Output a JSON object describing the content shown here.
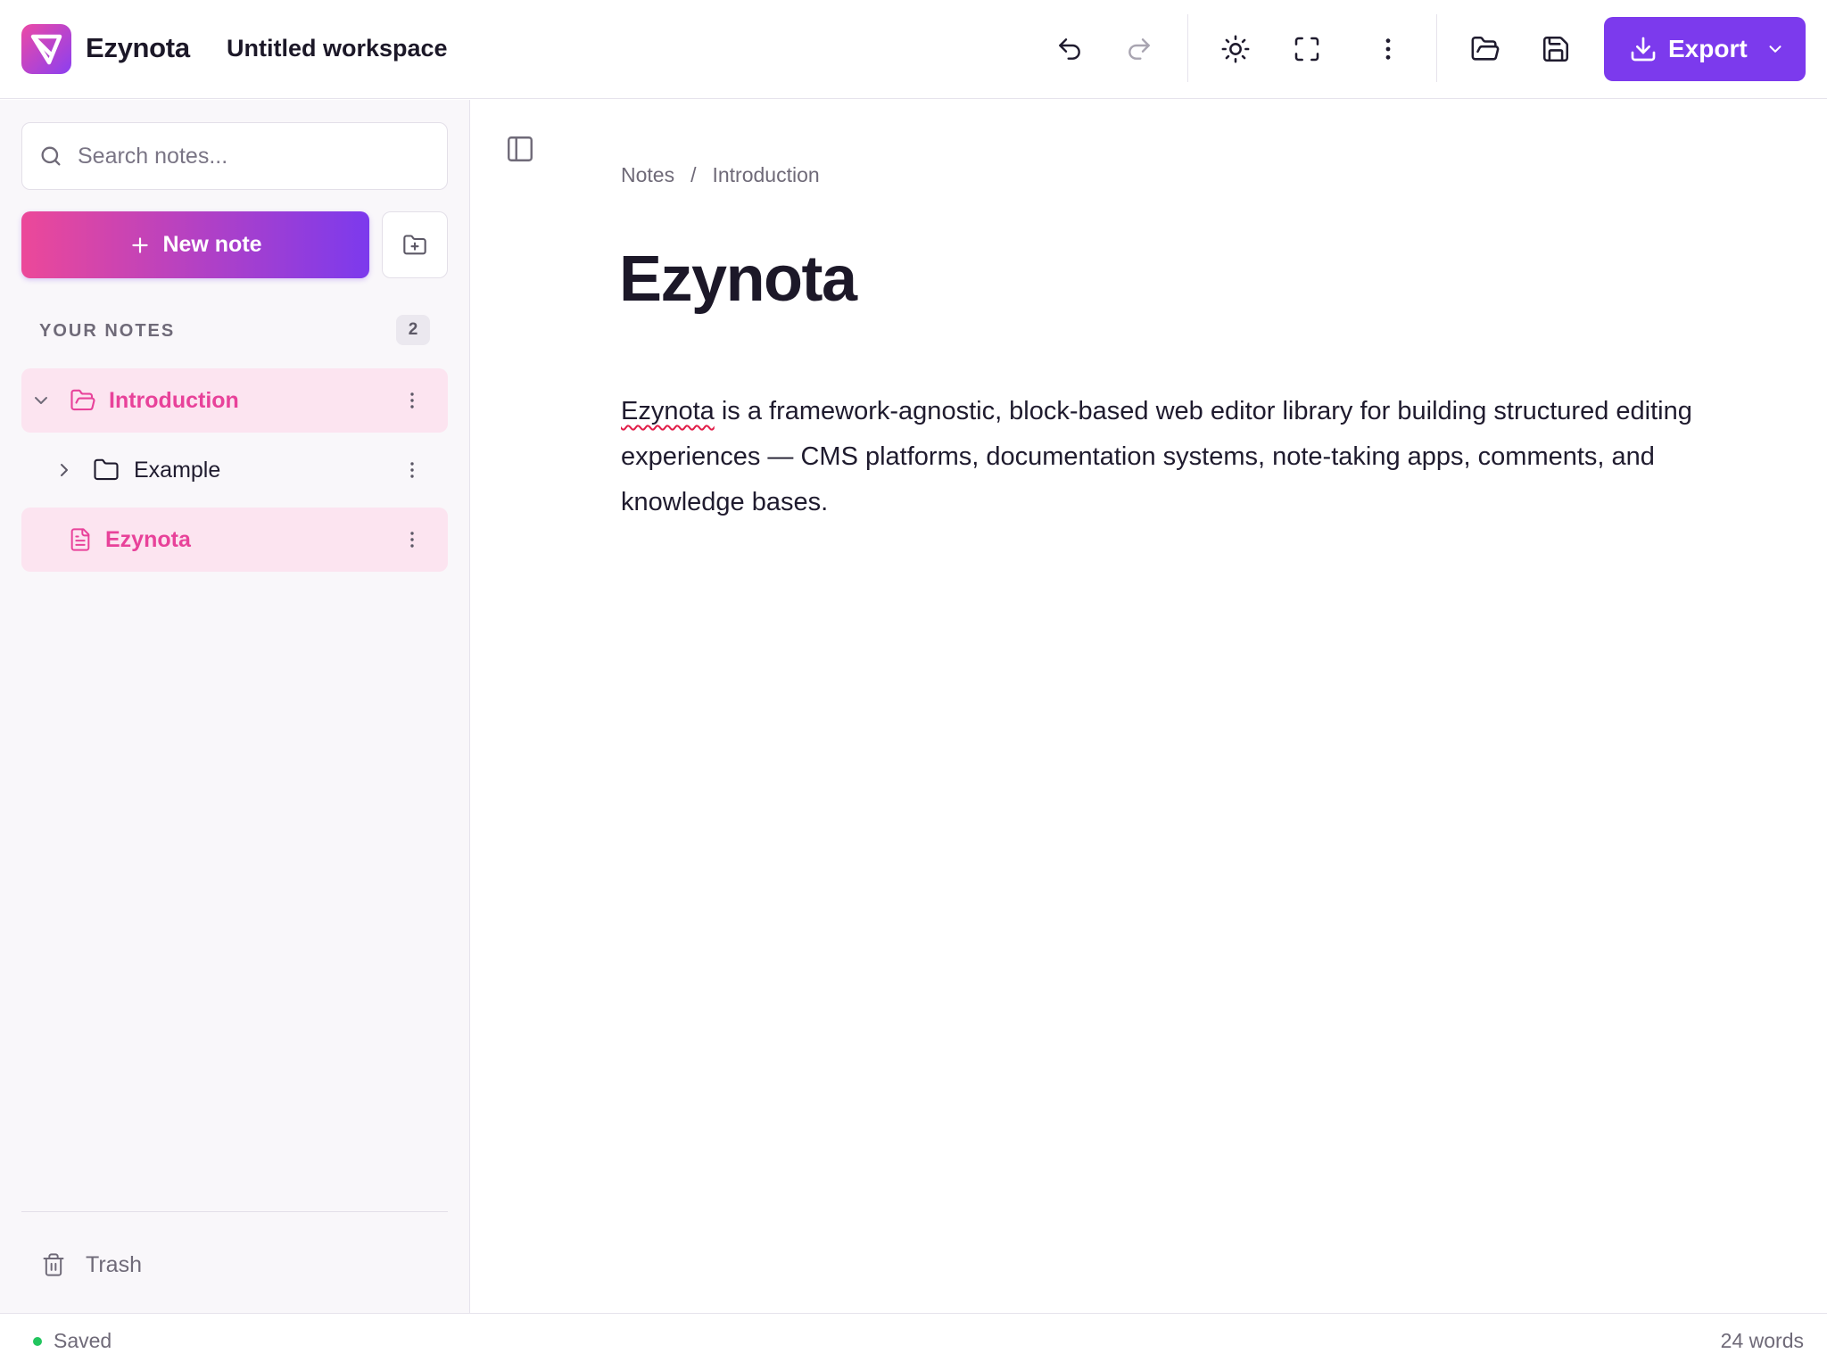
{
  "app": {
    "name": "Ezynota",
    "workspace_title": "Untitled workspace"
  },
  "toolbar": {
    "icons": [
      "undo-icon",
      "redo-icon",
      "sun-icon",
      "fullscreen-icon",
      "more-vertical-icon",
      "folder-open-icon",
      "save-icon"
    ],
    "export_label": "Export"
  },
  "sidebar": {
    "search_placeholder": "Search notes...",
    "new_note_label": "New note",
    "section_label": "YOUR NOTES",
    "notes_count": "2",
    "items": [
      {
        "label": "Introduction",
        "type": "folder",
        "expanded": true,
        "active": true
      },
      {
        "label": "Example",
        "type": "folder",
        "expanded": false,
        "active": false
      },
      {
        "label": "Ezynota",
        "type": "note",
        "active": true
      }
    ],
    "trash_label": "Trash"
  },
  "editor": {
    "breadcrumb": [
      "Notes",
      "Introduction"
    ],
    "breadcrumb_separator": "/",
    "title": "Ezynota",
    "body_misspelled_word": "Ezynota",
    "body_line1_rest": " is a framework-agnostic, block-based web editor library for building structured editing",
    "body_line2": "experiences — CMS platforms, documentation systems, note-taking apps, comments, and knowledge bases."
  },
  "status": {
    "saved_text": "Saved",
    "word_count": "24 words"
  },
  "colors": {
    "accent": "#7c3aed",
    "pink": "#e8429a",
    "active_bg": "#fce4f0",
    "saved_dot": "#22c55e"
  }
}
